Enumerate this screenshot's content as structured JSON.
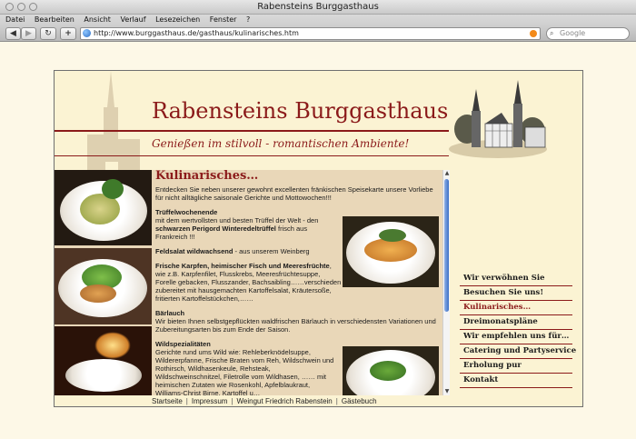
{
  "window": {
    "title": "Rabensteins Burggasthaus"
  },
  "menu": [
    "Datei",
    "Bearbeiten",
    "Ansicht",
    "Verlauf",
    "Lesezeichen",
    "Fenster",
    "?"
  ],
  "toolbar": {
    "back_icon": "back-arrow-icon",
    "forward_icon": "forward-arrow-icon",
    "reload_icon": "reload-icon",
    "add_icon": "plus-icon",
    "url": "http://www.burggasthaus.de/gasthaus/kulinarisches.htm",
    "search_placeholder": "Google"
  },
  "site": {
    "title": "Rabensteins Burggasthaus",
    "slogan": "Genießen im stilvoll - romantischen Ambiente!"
  },
  "content": {
    "heading": "Kulinarisches…",
    "intro": "Entdecken Sie neben unserer gewohnt excellenten fränkischen Speisekarte unsere Vorliebe für nicht alltägliche saisonale Gerichte und Mottowochen!!!",
    "s1_title": "Trüffelwochenende",
    "s1_text_a": "mit dem wertvollsten und besten Trüffel der Welt - den",
    "s1_bold": "schwarzen Perigord Winteredeltrüffel",
    "s1_text_b": "frisch aus Frankreich !!!",
    "s2_title": "Feldsalat wildwachsend",
    "s2_text": "- aus unserem Weinberg",
    "s3_title": "Frische Karpfen, heimischer Fisch und Meeresfrüchte",
    "s3_text": ", wie z.B. Karpfenfilet, Flusskrebs, Meeresfrüchtesuppe, Forelle gebacken, Flusszander, Bachsaibling……verschieden zubereitet mit hausgemachten Kartoffelsalat, Kräutersoße, fritierten Kartoffelstückchen,……",
    "s4_title": "Bärlauch",
    "s4_text": "Wir bieten Ihnen selbstgepflückten waldfrischen Bärlauch in verschiedensten Variationen und Zubereitungsarten bis zum Ende der Saison.",
    "s5_title": "Wildspezialitäten",
    "s5_text": "Gerichte rund ums Wild wie: Rehleberknödelsuppe, Wildererpfanne, Frische Braten vom Reh, Wildschwein und Rothirsch, Wildhasenkeule, Rehsteak, Wildschweinschnitzel, Filetrolle vom Wildhasen, …… mit heimischen Zutaten wie Rosenkohl, Apfelblaukraut, Williams-Christ Birne, Kartoffel u…"
  },
  "footer": {
    "links": [
      "Startseite",
      "Impressum",
      "Weingut Friedrich Rabenstein",
      "Gästebuch"
    ],
    "separator": "|"
  },
  "nav": [
    {
      "label": "Wir verwöhnen Sie",
      "active": false
    },
    {
      "label": "Besuchen Sie uns!",
      "active": false
    },
    {
      "label": "Kulinarisches…",
      "active": true
    },
    {
      "label": "Dreimonatspläne",
      "active": false
    },
    {
      "label": "Wir empfehlen uns für…",
      "active": false
    },
    {
      "label": "Catering und Partyservice",
      "active": false
    },
    {
      "label": "Erholung pur",
      "active": false
    },
    {
      "label": "Kontakt",
      "active": false
    }
  ],
  "colors": {
    "brand": "#8b1a1a",
    "page_bg": "#fbf3d3",
    "content_bg": "#e9d7b8"
  }
}
